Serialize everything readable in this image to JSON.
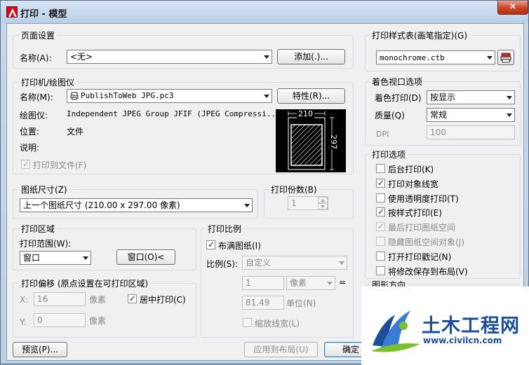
{
  "window": {
    "title": "打印 - 模型",
    "close_glyph": "×"
  },
  "page_setup": {
    "legend": "页面设置",
    "name_label": "名称(A):",
    "name_value": "<无>",
    "add_button": "添加(.)..."
  },
  "printer": {
    "legend": "打印机/绘图仪",
    "name_label": "名称(M):",
    "name_value": "PublishToWeb JPG.pc3",
    "properties_button": "特性(R)...",
    "plotter_label": "绘图仪:",
    "plotter_value": "Independent JPEG Group JFIF (JPEG Compressi...",
    "location_label": "位置:",
    "location_value": "文件",
    "description_label": "说明:",
    "print_to_file_label": "打印到文件(F)",
    "print_to_file_checked": true,
    "preview_width": "210",
    "preview_height": "297"
  },
  "paper_size": {
    "legend": "图纸尺寸(Z)",
    "value": "上一个图纸尺寸  (210.00 x 297.00 像素)"
  },
  "copies": {
    "legend": "打印份数(B)",
    "value": "1"
  },
  "plot_area": {
    "legend": "打印区域",
    "range_label": "打印范围(W):",
    "range_value": "窗口",
    "window_button": "窗口(O)<"
  },
  "plot_offset": {
    "legend": "打印偏移 (原点设置在可打印区域)",
    "x_label": "X:",
    "x_value": "16",
    "x_unit": "像素",
    "y_label": "Y:",
    "y_value": "0",
    "y_unit": "像素",
    "center_label": "居中打印(C)",
    "center_checked": true
  },
  "plot_scale": {
    "legend": "打印比例",
    "fit_label": "布满图纸(I)",
    "fit_checked": true,
    "scale_label": "比例(S):",
    "scale_value": "自定义",
    "value1": "1",
    "unit_value": "像素",
    "equals": "=",
    "value2": "81.49",
    "unit_label": "单位(N)",
    "scale_lineweights_label": "缩放线宽(L)",
    "scale_lineweights_checked": false
  },
  "plot_style_table": {
    "legend": "打印样式表(画笔指定)(G)",
    "value": "monochrome.ctb"
  },
  "shaded_viewport": {
    "legend": "着色视口选项",
    "shade_plot_label": "着色打印(D)",
    "shade_plot_value": "按显示",
    "quality_label": "质量(Q)",
    "quality_value": "常规",
    "dpi_label": "DPI",
    "dpi_value": "100"
  },
  "plot_options": {
    "legend": "打印选项",
    "items": [
      {
        "label": "后台打印(K)",
        "checked": false,
        "disabled": false
      },
      {
        "label": "打印对象线宽",
        "checked": true,
        "disabled": false
      },
      {
        "label": "使用透明度打印(T)",
        "checked": false,
        "disabled": false
      },
      {
        "label": "按样式打印(E)",
        "checked": true,
        "disabled": false
      },
      {
        "label": "最后打印图纸空间",
        "checked": true,
        "disabled": true
      },
      {
        "label": "隐藏图纸空间对象(J)",
        "checked": false,
        "disabled": true
      },
      {
        "label": "打开打印戳记(N)",
        "checked": false,
        "disabled": false
      },
      {
        "label": "将修改保存到布局(V)",
        "checked": false,
        "disabled": false
      }
    ]
  },
  "drawing_orientation_partial": "图形方向",
  "footer": {
    "preview_button": "预览(P)...",
    "apply_button": "应用到布局(U)",
    "ok_button": "确定"
  },
  "watermark": {
    "title": "土木工程网",
    "url": "www.civilcn.com"
  },
  "colors": {
    "title_icon_red": "#c8101b",
    "watermark_blue": "#1d4f98",
    "watermark_green": "#7bbf2a"
  }
}
